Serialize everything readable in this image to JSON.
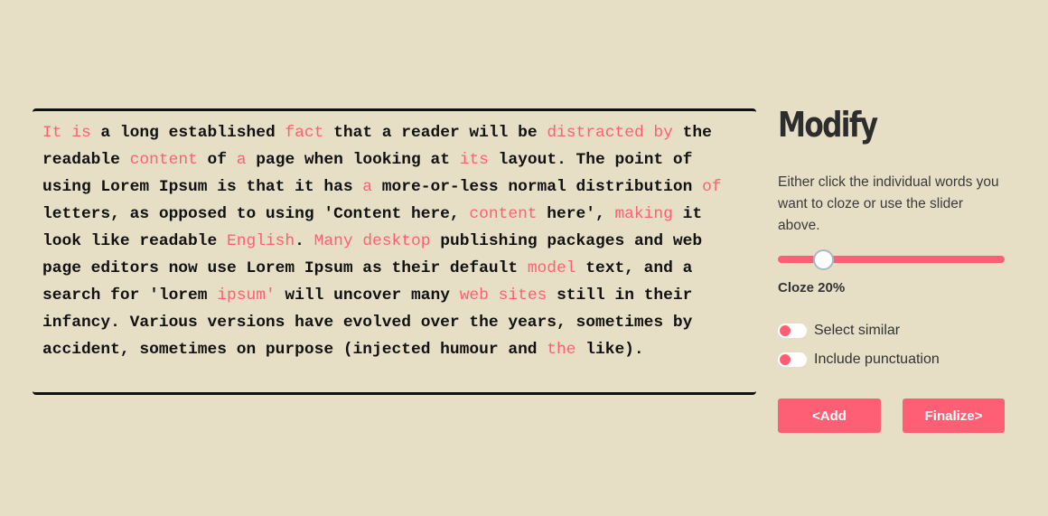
{
  "editor": {
    "lines": [
      [
        {
          "t": "It is",
          "h": true
        },
        {
          "t": " a long established "
        },
        {
          "t": "fact",
          "h": true
        },
        {
          "t": " that a reader will be "
        },
        {
          "t": "distracted by",
          "h": true
        },
        {
          "t": " the"
        }
      ],
      [
        {
          "t": "readable "
        },
        {
          "t": "content",
          "h": true
        },
        {
          "t": " of "
        },
        {
          "t": "a",
          "h": true
        },
        {
          "t": " page when looking at "
        },
        {
          "t": "its",
          "h": true
        },
        {
          "t": " layout. The point of"
        }
      ],
      [
        {
          "t": "using Lorem Ipsum is that it has "
        },
        {
          "t": "a",
          "h": true
        },
        {
          "t": " more-or-less normal distribution "
        },
        {
          "t": "of",
          "h": true
        }
      ],
      [
        {
          "t": "letters, as opposed to using 'Content here, "
        },
        {
          "t": "content",
          "h": true
        },
        {
          "t": " here', "
        },
        {
          "t": "making",
          "h": true
        },
        {
          "t": " it"
        }
      ],
      [
        {
          "t": "look like readable "
        },
        {
          "t": "English",
          "h": true
        },
        {
          "t": ". "
        },
        {
          "t": "Many desktop",
          "h": true
        },
        {
          "t": " publishing packages and web"
        }
      ],
      [
        {
          "t": "page editors now use Lorem Ipsum as their default "
        },
        {
          "t": "model",
          "h": true
        },
        {
          "t": " text, and a"
        }
      ],
      [
        {
          "t": "search for 'lorem "
        },
        {
          "t": "ipsum'",
          "h": true
        },
        {
          "t": " will uncover many "
        },
        {
          "t": "web sites",
          "h": true
        },
        {
          "t": " still in their"
        }
      ],
      [
        {
          "t": "infancy. Various versions have evolved over the years, sometimes by"
        }
      ],
      [
        {
          "t": "accident, sometimes on purpose (injected humour and "
        },
        {
          "t": "the",
          "h": true
        },
        {
          "t": " like)."
        }
      ]
    ]
  },
  "panel": {
    "title": "Modify",
    "description": "Either click the individual words you want to cloze or use the slider above.",
    "slider_percent": 20,
    "cloze_label": "Cloze 20%",
    "toggles": [
      {
        "label": "Select similar",
        "on": false
      },
      {
        "label": "Include punctuation",
        "on": false
      }
    ],
    "add_label": "<Add",
    "finalize_label": "Finalize>"
  },
  "colors": {
    "background": "#e6dfc6",
    "accent": "#ff5f74"
  }
}
